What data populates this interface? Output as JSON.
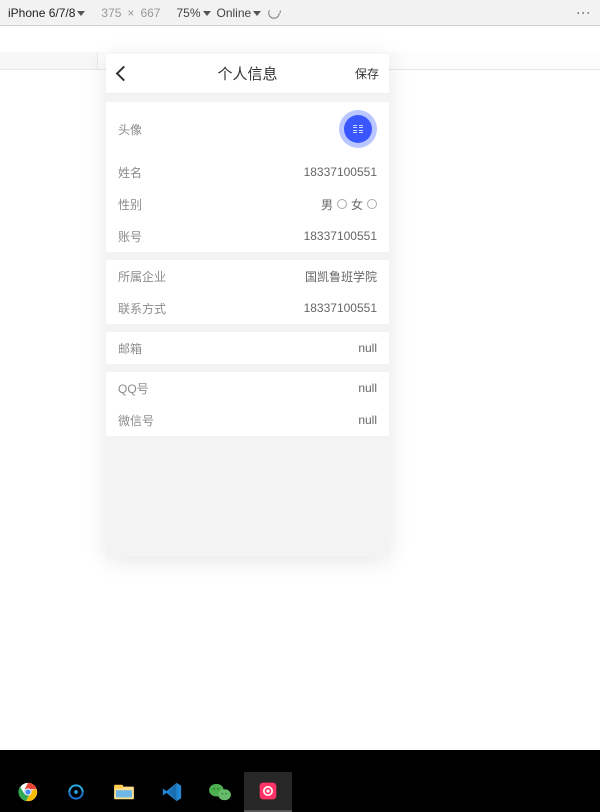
{
  "devtools": {
    "device": "iPhone 6/7/8",
    "width": "375",
    "times": "×",
    "height": "667",
    "zoom": "75%",
    "network": "Online"
  },
  "header": {
    "title": "个人信息",
    "save": "保存"
  },
  "section1": {
    "avatar_label": "头像",
    "name_label": "姓名",
    "name_value": "18337100551",
    "gender_label": "性别",
    "gender_male": "男",
    "gender_female": "女",
    "account_label": "账号",
    "account_value": "18337100551"
  },
  "section2": {
    "company_label": "所属企业",
    "company_value": "国凯鲁班学院",
    "contact_label": "联系方式",
    "contact_value": "18337100551"
  },
  "section3": {
    "email_label": "邮箱",
    "email_value": "null"
  },
  "section4": {
    "qq_label": "QQ号",
    "qq_value": "null",
    "wechat_label": "微信号",
    "wechat_value": "null"
  }
}
